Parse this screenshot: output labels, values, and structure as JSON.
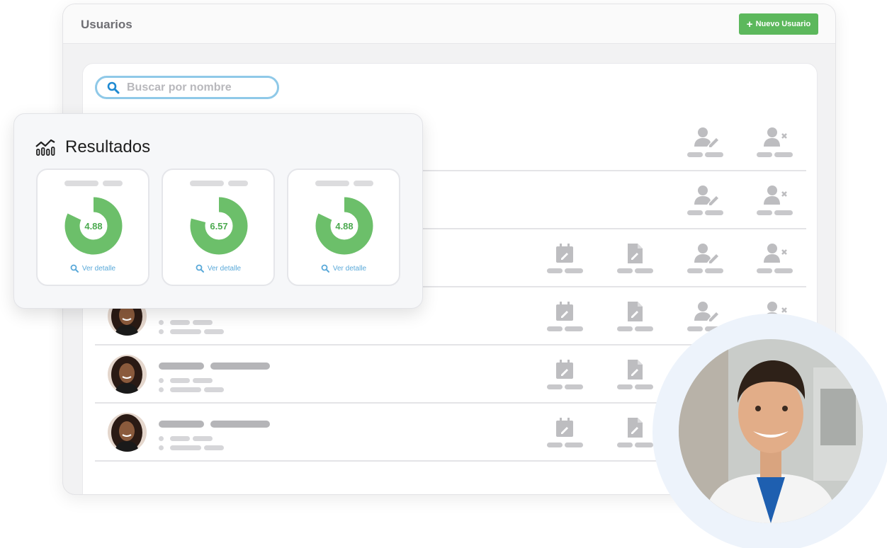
{
  "window": {
    "title": "Usuarios",
    "new_user_label": "Nuevo Usuario"
  },
  "search": {
    "placeholder": "Buscar por nombre"
  },
  "results": {
    "title": "Resultados",
    "cards": [
      {
        "value": "4.88",
        "link_label": "Ver detalle",
        "fill": 0.82
      },
      {
        "value": "6.57",
        "link_label": "Ver detalle",
        "fill": 0.79
      },
      {
        "value": "4.88",
        "link_label": "Ver detalle",
        "fill": 0.82
      }
    ]
  },
  "icons": {
    "search": "search-icon",
    "plus": "plus-icon",
    "chart": "chart-line-icon",
    "calendar_edit": "calendar-edit-icon",
    "document_edit": "document-edit-icon",
    "user_edit": "user-edit-icon",
    "user_delete": "user-delete-icon"
  },
  "colors": {
    "accent_green": "#5cb85c",
    "donut_green": "#6cbf6a",
    "search_border": "#8fc9e8",
    "link_blue": "#5aa9d9"
  }
}
